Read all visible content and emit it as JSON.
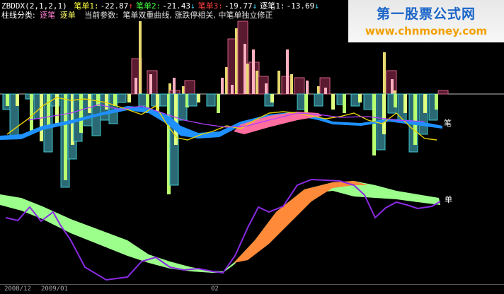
{
  "indicator_header": {
    "name": "ZBDDX(2,1,2,1)",
    "items": [
      {
        "label": "笔单1:",
        "value": "-22.87",
        "arrow": "↑",
        "color": "#ffff40",
        "value_color": "#ffffff",
        "arrow_color": "#ff4040"
      },
      {
        "label": "笔单2:",
        "value": "-21.43",
        "arrow": "↓",
        "color": "#40ff40",
        "value_color": "#ffffff",
        "arrow_color": "#40e0ff"
      },
      {
        "label": "笔单3:",
        "value": "-19.77",
        "arrow": "↓",
        "color": "#ff4040",
        "value_color": "#ffffff",
        "arrow_color": "#40e0ff"
      },
      {
        "label": "逐笔1:",
        "value": "-13.69",
        "arrow": "↓",
        "color": "#ffffff",
        "value_color": "#ffffff",
        "arrow_color": "#40e0ff"
      }
    ]
  },
  "subheader": {
    "prefix": "柱线分类:",
    "tag_zhubi": "逐笔",
    "tag_zhudan": "逐单",
    "params_label": "当前参数:",
    "params_text": "笔单双重曲线, 涨跌停相关, 中笔单独立修正"
  },
  "panel_labels": {
    "bi": "笔",
    "dan": "单"
  },
  "x_axis": {
    "ticks": [
      "2008/12",
      "2009/01",
      "02"
    ]
  },
  "watermark": {
    "title": "第一股票公式网",
    "url": "www.chnmoney.com"
  },
  "colors": {
    "blue_band": "#1e90ff",
    "pink_band": "#ff6e9e",
    "green_band": "#9cff8c",
    "orange_band": "#ff8a3a",
    "purple_line": "#8a2be2",
    "yellow_line": "#e8d200"
  }
}
